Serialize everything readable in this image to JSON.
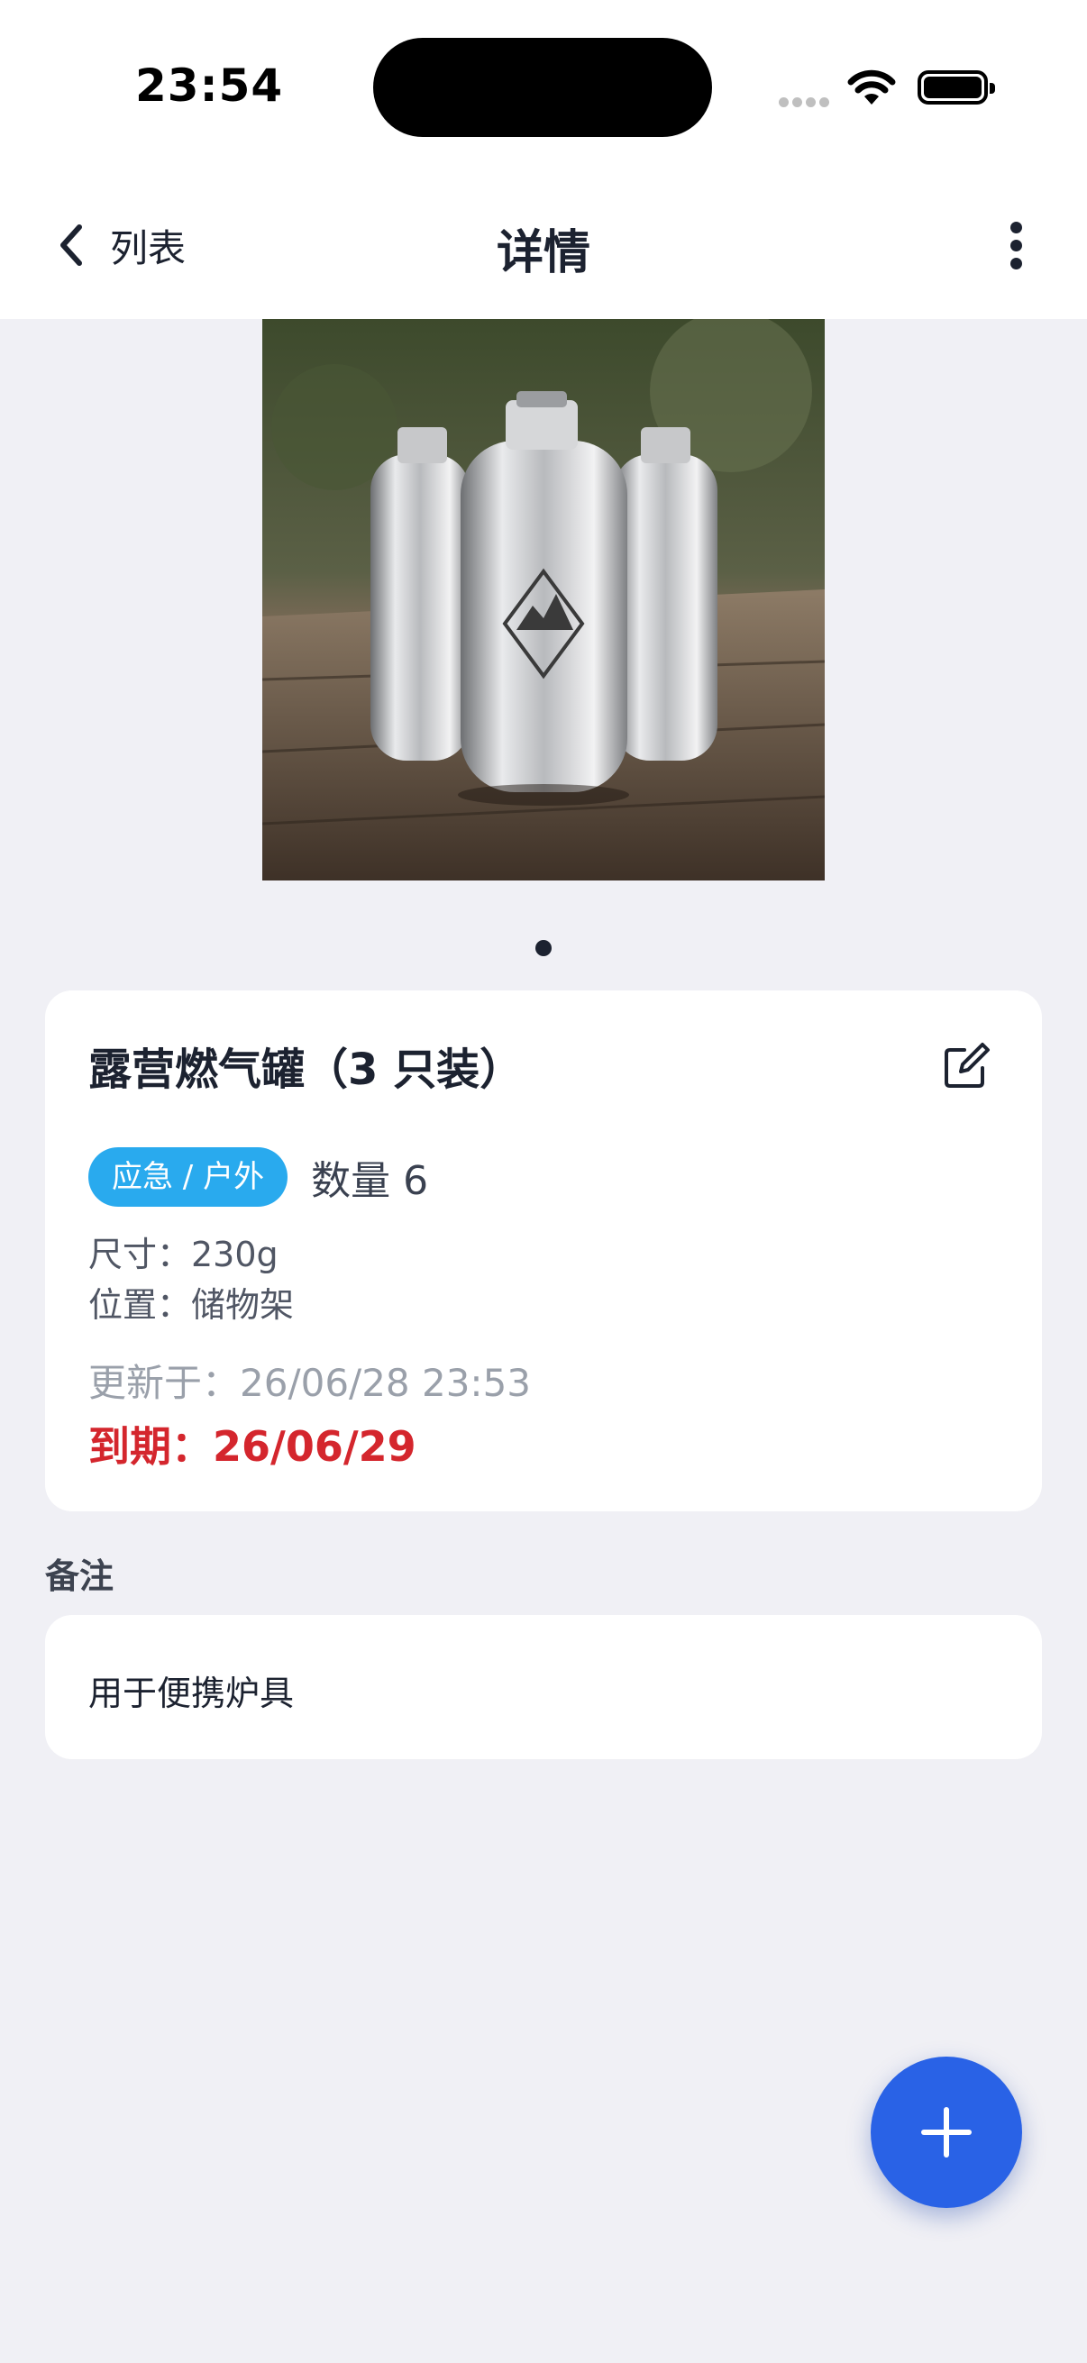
{
  "status_bar": {
    "time": "23:54"
  },
  "nav": {
    "back_label": "列表",
    "title": "详情"
  },
  "gallery": {
    "pages": 1,
    "current_page": 1
  },
  "item": {
    "title": "露营燃气罐（3 只装）",
    "category_tag": "应急 / 户外",
    "quantity": "数量 6",
    "size": "尺寸：230g",
    "location": "位置：储物架",
    "updated": "更新于：26/06/28 23:53",
    "expiry": "到期：26/06/29"
  },
  "notes": {
    "heading": "备注",
    "text": "用于便携炉具"
  },
  "colors": {
    "accent": "#2962e6",
    "tag": "#29aaee",
    "expiry": "#d4262d",
    "background": "#f0f0f5"
  },
  "icons": [
    "chevron-left-icon",
    "more-vertical-icon",
    "edit-icon",
    "plus-icon",
    "wifi-icon",
    "battery-icon"
  ]
}
